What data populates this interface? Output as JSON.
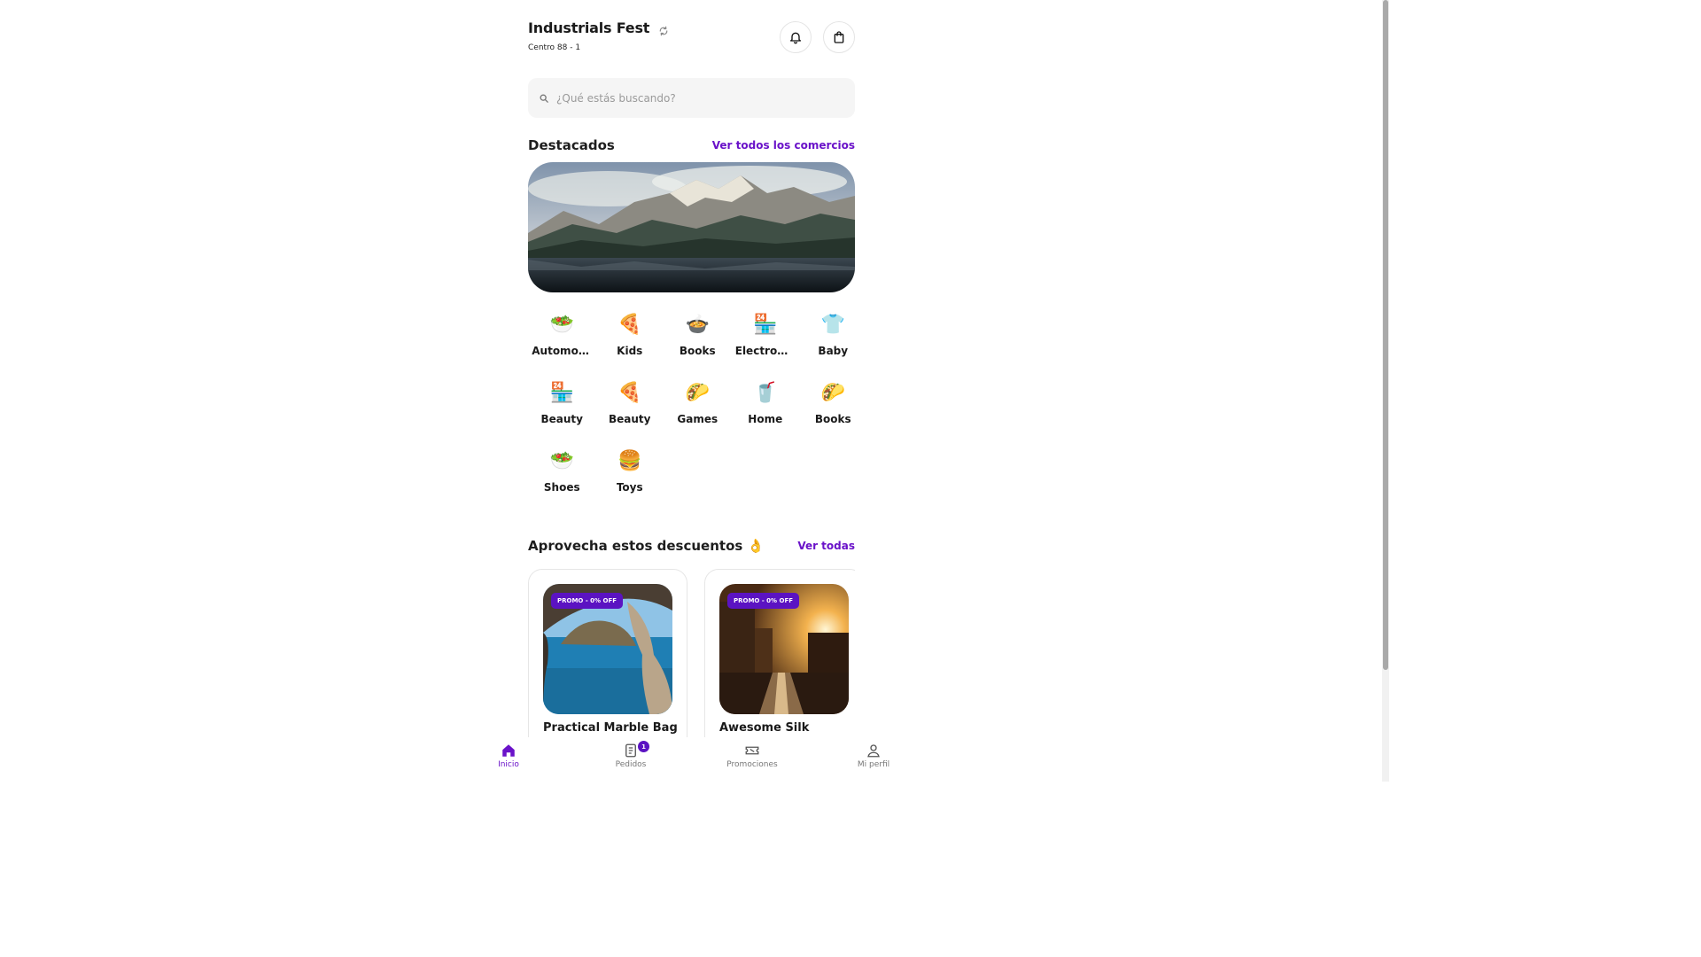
{
  "header": {
    "title": "Industrials Fest",
    "subtitle": "Centro 88 - 1",
    "icons": {
      "refresh": "refresh-icon",
      "notifications": "bell-icon",
      "cart": "shopping-bag-icon"
    }
  },
  "search": {
    "placeholder": "¿Qué estás buscando?",
    "value": ""
  },
  "featured": {
    "title": "Destacados",
    "link": "Ver todos los comercios",
    "banner_alt": "mountain-lake-banner"
  },
  "categories": [
    {
      "label": "Automotive",
      "icon": "🥗"
    },
    {
      "label": "Kids",
      "icon": "🍕"
    },
    {
      "label": "Books",
      "icon": "🍲"
    },
    {
      "label": "Electronics",
      "icon": "🏪"
    },
    {
      "label": "Baby",
      "icon": "👕"
    },
    {
      "label": "Beauty",
      "icon": "🏪"
    },
    {
      "label": "Beauty",
      "icon": "🍕"
    },
    {
      "label": "Games",
      "icon": "🌮"
    },
    {
      "label": "Home",
      "icon": "🥤"
    },
    {
      "label": "Books",
      "icon": "🌮"
    },
    {
      "label": "Shoes",
      "icon": "🥗"
    },
    {
      "label": "Toys",
      "icon": "🍔"
    }
  ],
  "discounts": {
    "title": "Aprovecha estos descuentos",
    "emoji": "👌",
    "link": "Ver todas",
    "items": [
      {
        "badge": "PROMO - 0% OFF",
        "name": "Practical Marble Bag"
      },
      {
        "badge": "PROMO - 0% OFF",
        "name": "Awesome Silk"
      }
    ]
  },
  "bottom_nav": [
    {
      "label": "Inicio",
      "active": true,
      "icon": "home-icon"
    },
    {
      "label": "Pedidos",
      "active": false,
      "icon": "orders-icon",
      "badge": "1"
    },
    {
      "label": "Promociones",
      "active": false,
      "icon": "ticket-icon"
    },
    {
      "label": "Mi perfil",
      "active": false,
      "icon": "user-icon"
    }
  ],
  "colors": {
    "accent": "#6a12c9",
    "badge": "#5b13c2",
    "text": "#1a1a1a"
  }
}
